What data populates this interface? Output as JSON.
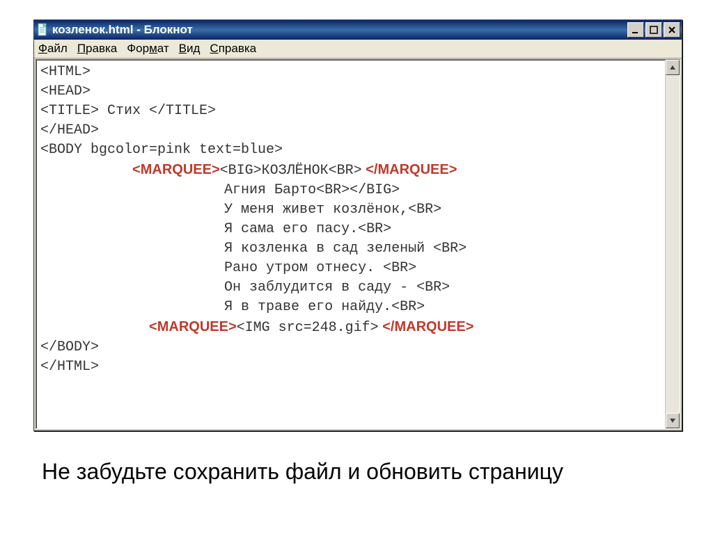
{
  "window": {
    "title": "козленок.html - Блокнот"
  },
  "menu": {
    "file": "Файл",
    "edit": "Правка",
    "format": "Формат",
    "view": "Вид",
    "help": "Справка"
  },
  "code": {
    "l01": "<HTML>",
    "l02": "<HEAD>",
    "l03": "<TITLE> Стих </TITLE>",
    "l04": "</HEAD>",
    "l05": "<BODY bgcolor=pink text=blue>",
    "l06_pre": "           ",
    "l06_code": "<BIG>КОЗЛЁНОК<BR>",
    "l07": "                      Агния Барто<BR></BIG>",
    "l08": "                      У меня живет козлёнок,<BR>",
    "l09": "                      Я сама его пасу.<BR>",
    "l10": "                      Я козленка в сад зеленый <BR>",
    "l11": "                      Рано утром отнесу. <BR>",
    "l12": "                      Он заблудится в саду - <BR>",
    "l13": "                      Я в траве его найду.<BR>",
    "l14_pre": "             ",
    "l14_code": "<IMG src=248.gif>",
    "l15": "</BODY>",
    "l16": "</HTML>"
  },
  "annot": {
    "marquee_open": "<MARQUEE>",
    "marquee_close": " </MARQUEE>"
  },
  "caption": "Не забудьте сохранить файл и обновить страницу"
}
